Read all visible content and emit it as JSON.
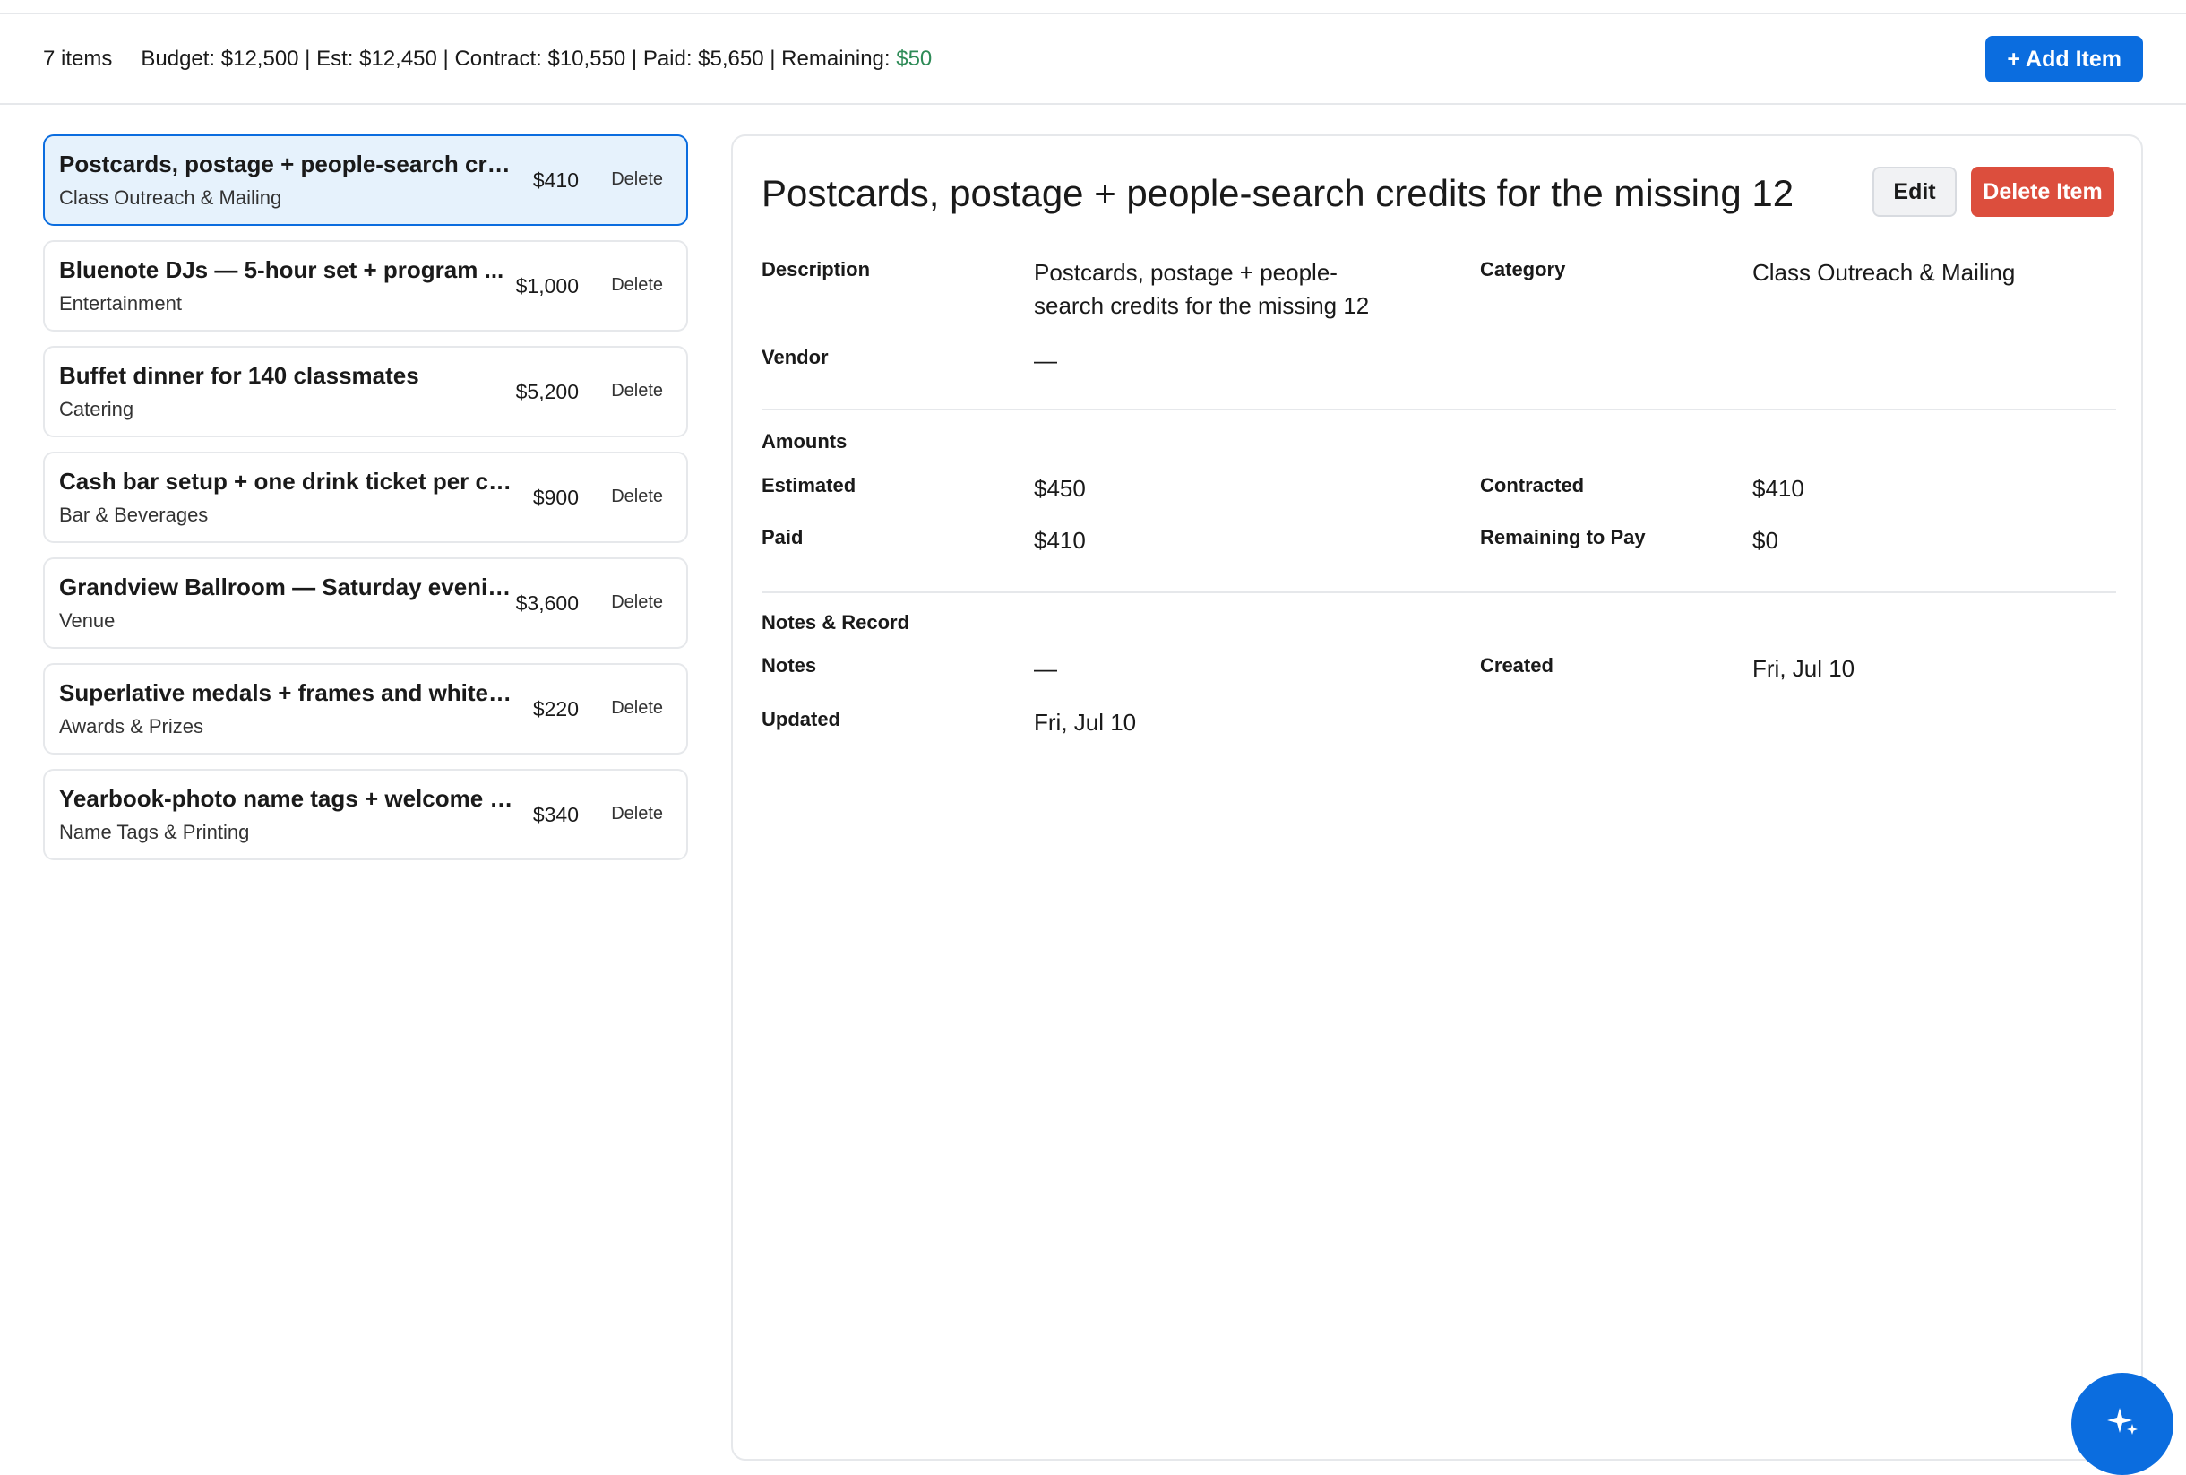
{
  "toolbar": {
    "count": "7 items",
    "budget": "Budget: $12,500",
    "est": "Est: $12,450",
    "contract": "Contract: $10,550",
    "paid": "Paid: $5,650",
    "remaining_label": "Remaining: ",
    "remaining_value": "$50",
    "add_label": "+ Add Item"
  },
  "items": [
    {
      "title": "Postcards, postage + people-search credi...",
      "category": "Class Outreach & Mailing",
      "amount": "$410",
      "delete": "Delete"
    },
    {
      "title": "Bluenote DJs — 5-hour set + program ...",
      "category": "Entertainment",
      "amount": "$1,000",
      "delete": "Delete"
    },
    {
      "title": "Buffet dinner for 140 classmates",
      "category": "Catering",
      "amount": "$5,200",
      "delete": "Delete"
    },
    {
      "title": "Cash bar setup + one drink ticket per clas...",
      "category": "Bar & Beverages",
      "amount": "$900",
      "delete": "Delete"
    },
    {
      "title": "Grandview Ballroom — Saturday evenin...",
      "category": "Venue",
      "amount": "$3,600",
      "delete": "Delete"
    },
    {
      "title": "Superlative medals + frames and white ro...",
      "category": "Awards & Prizes",
      "amount": "$220",
      "delete": "Delete"
    },
    {
      "title": "Yearbook-photo name tags + welcome ba...",
      "category": "Name Tags & Printing",
      "amount": "$340",
      "delete": "Delete"
    }
  ],
  "detail": {
    "title": "Postcards, postage + people-search credits for the missing 12",
    "edit_label": "Edit",
    "delete_label": "Delete Item",
    "description_label": "Description",
    "description_line1": "Postcards, postage + people-",
    "description_line2": "search credits for the missing 12",
    "category_label": "Category",
    "category_value": "Class Outreach & Mailing",
    "vendor_label": "Vendor",
    "vendor_value": "—",
    "amounts_heading": "Amounts",
    "estimated_label": "Estimated",
    "estimated_value": "$450",
    "contracted_label": "Contracted",
    "contracted_value": "$410",
    "paid_label": "Paid",
    "paid_value": "$410",
    "remaining_label": "Remaining to Pay",
    "remaining_value": "$0",
    "notes_heading": "Notes & Record",
    "notes_label": "Notes",
    "notes_value": "—",
    "created_label": "Created",
    "created_value": "Fri, Jul 10",
    "updated_label": "Updated",
    "updated_value": "Fri, Jul 10"
  },
  "colors": {
    "accent": "#0b6ddf",
    "danger": "#dc4e3d",
    "remaining_positive": "#2e8b57",
    "selected_bg": "#e6f2fc"
  },
  "icons": {
    "fab": "sparkle-icon"
  }
}
